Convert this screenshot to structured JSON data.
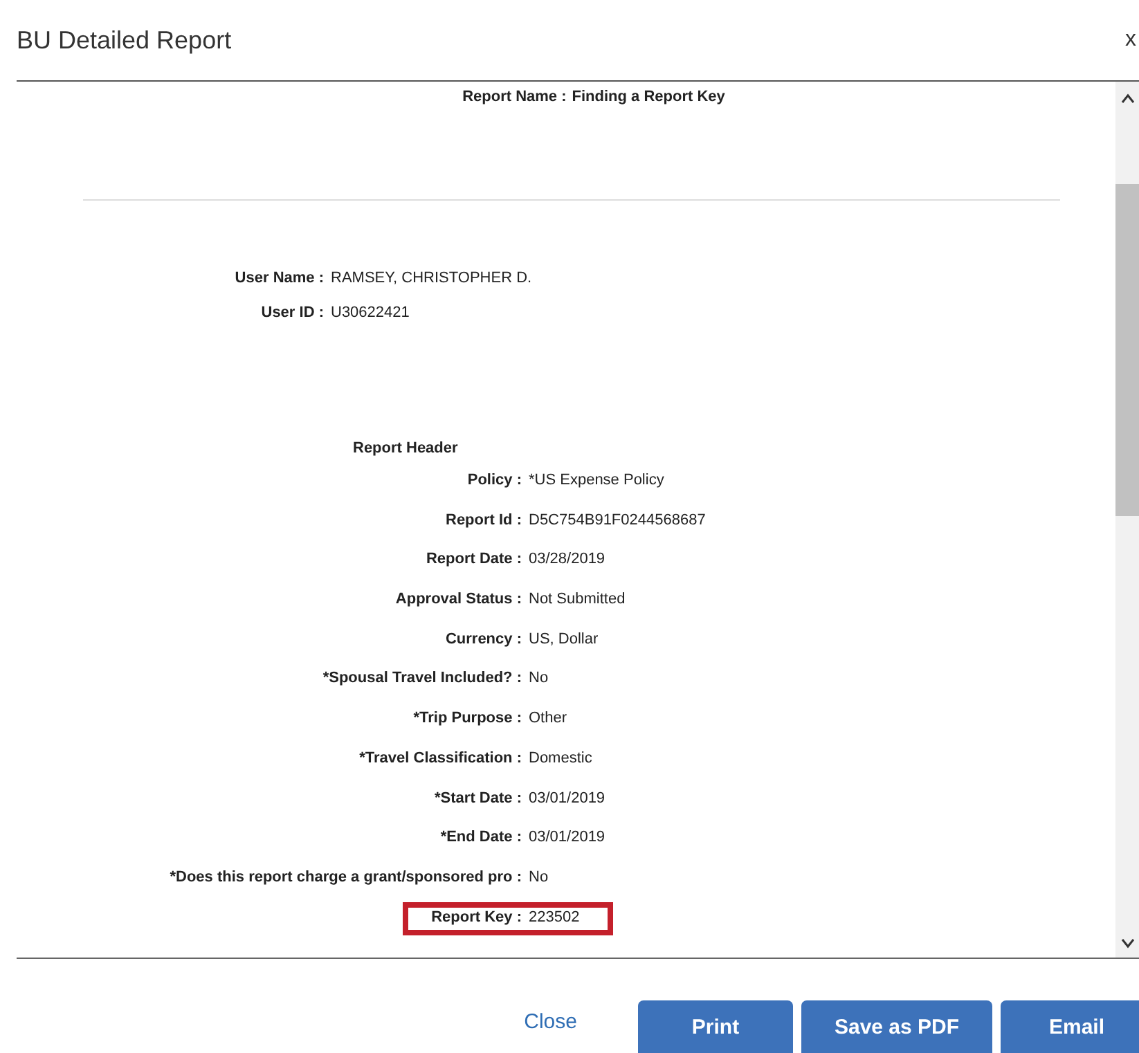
{
  "dialog": {
    "title": "BU Detailed Report",
    "close_glyph": "x"
  },
  "report_name": {
    "label": "Report Name :",
    "value": "Finding a Report Key"
  },
  "user_fields": [
    {
      "label": "User Name :",
      "value": "RAMSEY, CHRISTOPHER D."
    },
    {
      "label": "User ID :",
      "value": "U30622421"
    }
  ],
  "section_heading": "Report Header",
  "header_fields": [
    {
      "label": "Policy :",
      "value": "*US Expense Policy",
      "highlighted": false
    },
    {
      "label": "Report Id :",
      "value": "D5C754B91F0244568687",
      "highlighted": false
    },
    {
      "label": "Report Date :",
      "value": "03/28/2019",
      "highlighted": false
    },
    {
      "label": "Approval Status :",
      "value": "Not Submitted",
      "highlighted": false
    },
    {
      "label": "Currency :",
      "value": "US, Dollar",
      "highlighted": false
    },
    {
      "label": "*Spousal Travel Included? :",
      "value": "No",
      "highlighted": false
    },
    {
      "label": "*Trip Purpose :",
      "value": "Other",
      "highlighted": false
    },
    {
      "label": "*Travel Classification :",
      "value": "Domestic",
      "highlighted": false
    },
    {
      "label": "*Start Date :",
      "value": "03/01/2019",
      "highlighted": false
    },
    {
      "label": "*End Date :",
      "value": "03/01/2019",
      "highlighted": false
    },
    {
      "label": "*Does this report charge a grant/sponsored pro :",
      "value": "No",
      "highlighted": false
    },
    {
      "label": "Report Key :",
      "value": "223502",
      "highlighted": true
    }
  ],
  "buttons": [
    {
      "label": "Close",
      "kind": "link"
    },
    {
      "label": "Print",
      "kind": "primary"
    },
    {
      "label": "Save as PDF",
      "kind": "primary"
    },
    {
      "label": "Email",
      "kind": "primary"
    }
  ]
}
